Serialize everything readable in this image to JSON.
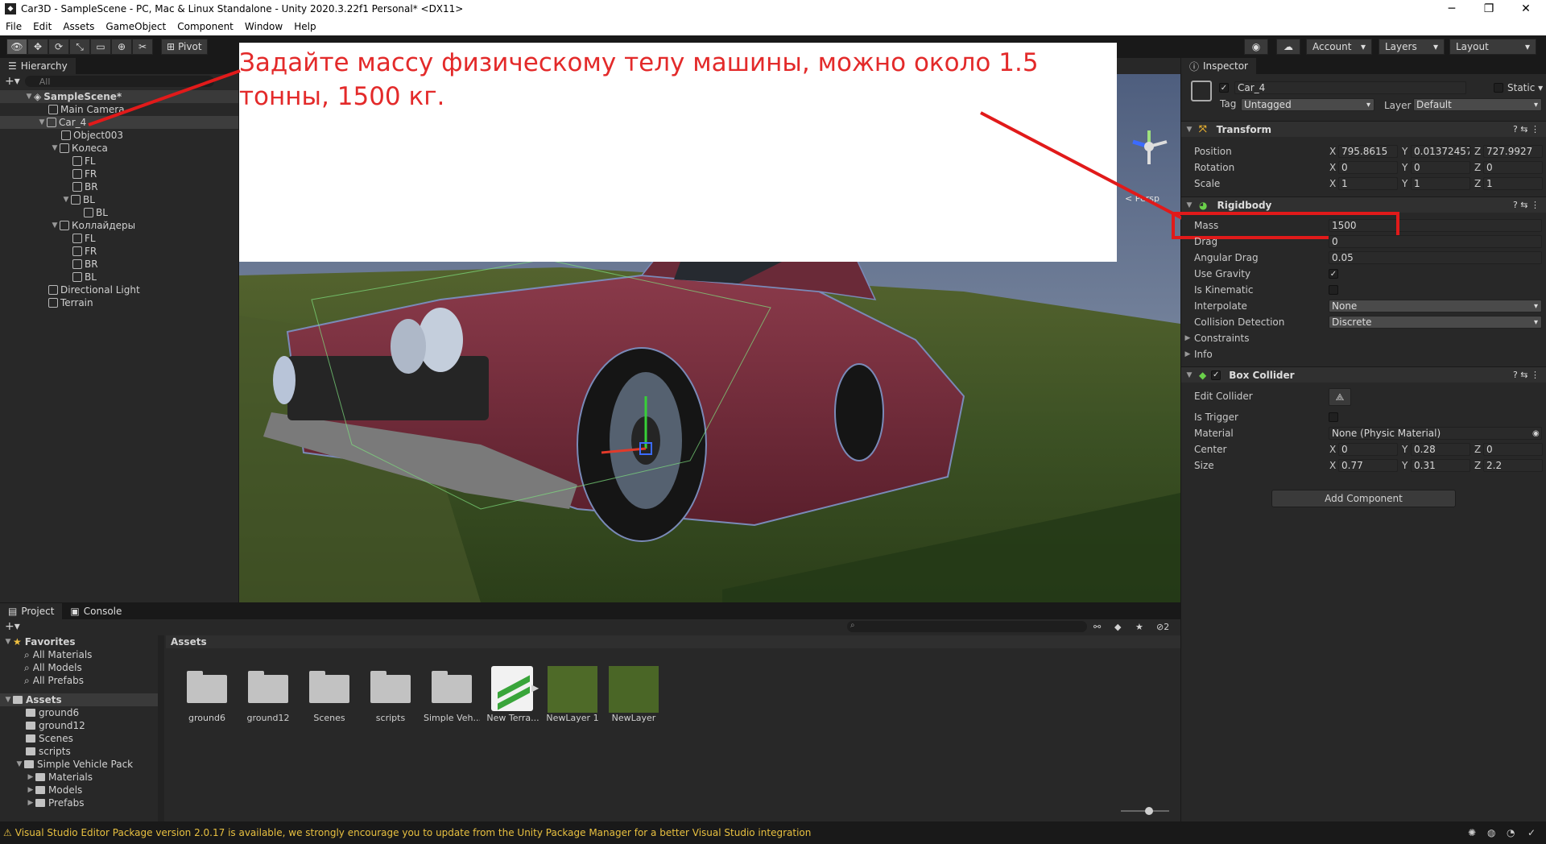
{
  "window": {
    "title": "Car3D - SampleScene - PC, Mac & Linux Standalone - Unity 2020.3.22f1 Personal* <DX11>"
  },
  "menu": [
    "File",
    "Edit",
    "Assets",
    "GameObject",
    "Component",
    "Window",
    "Help"
  ],
  "toolbar": {
    "pivot": "Pivot",
    "account": "Account",
    "layers": "Layers",
    "layout": "Layout"
  },
  "hierarchy": {
    "tab": "Hierarchy",
    "search_placeholder": "All",
    "scene": "SampleScene*",
    "items": [
      {
        "label": "Main Camera"
      },
      {
        "label": "Car_4"
      },
      {
        "label": "Object003"
      },
      {
        "label": "Колеса"
      },
      {
        "label": "FL"
      },
      {
        "label": "FR"
      },
      {
        "label": "BR"
      },
      {
        "label": "BL"
      },
      {
        "label": "BL"
      },
      {
        "label": "Коллайдеры"
      },
      {
        "label": "FL"
      },
      {
        "label": "FR"
      },
      {
        "label": "BR"
      },
      {
        "label": "BL"
      },
      {
        "label": "Directional Light"
      },
      {
        "label": "Terrain"
      }
    ]
  },
  "annotation": {
    "text": "Задайте массу физическому телу машины, можно около 1.5 тонны, 1500 кг."
  },
  "scene_view": {
    "persp_label": "< Persp"
  },
  "inspector": {
    "tab": "Inspector",
    "object_name": "Car_4",
    "static_label": "Static",
    "tag_label": "Tag",
    "tag_value": "Untagged",
    "layer_label": "Layer",
    "layer_value": "Default",
    "transform": {
      "title": "Transform",
      "position_label": "Position",
      "position": [
        "795.8615",
        "0.01372457",
        "727.9927"
      ],
      "rotation_label": "Rotation",
      "rotation": [
        "0",
        "0",
        "0"
      ],
      "scale_label": "Scale",
      "scale": [
        "1",
        "1",
        "1"
      ]
    },
    "rigidbody": {
      "title": "Rigidbody",
      "mass_label": "Mass",
      "mass": "1500",
      "drag_label": "Drag",
      "drag": "0",
      "angular_drag_label": "Angular Drag",
      "angular_drag": "0.05",
      "use_gravity_label": "Use Gravity",
      "is_kinematic_label": "Is Kinematic",
      "interpolate_label": "Interpolate",
      "interpolate": "None",
      "collision_label": "Collision Detection",
      "collision": "Discrete",
      "constraints_label": "Constraints",
      "info_label": "Info"
    },
    "box_collider": {
      "title": "Box Collider",
      "edit_collider_label": "Edit Collider",
      "is_trigger_label": "Is Trigger",
      "material_label": "Material",
      "material": "None (Physic Material)",
      "center_label": "Center",
      "center": [
        "0",
        "0.28",
        "0"
      ],
      "size_label": "Size",
      "size": [
        "0.77",
        "0.31",
        "2.2"
      ]
    },
    "add_component": "Add Component"
  },
  "project": {
    "tab_project": "Project",
    "tab_console": "Console",
    "favorites_label": "Favorites",
    "favorites": [
      "All Materials",
      "All Models",
      "All Prefabs"
    ],
    "assets_label": "Assets",
    "tree": [
      "ground6",
      "ground12",
      "Scenes",
      "scripts",
      "Simple Vehicle Pack",
      "Materials",
      "Models",
      "Prefabs"
    ],
    "breadcrumb": "Assets",
    "hidden_count": "2",
    "assets": [
      "ground6",
      "ground12",
      "Scenes",
      "scripts",
      "Simple Veh...",
      "New Terra...",
      "NewLayer 1",
      "NewLayer"
    ]
  },
  "status": {
    "message": "Visual Studio Editor Package version 2.0.17 is available, we strongly encourage you to update from the Unity Package Manager for a better Visual Studio integration"
  }
}
